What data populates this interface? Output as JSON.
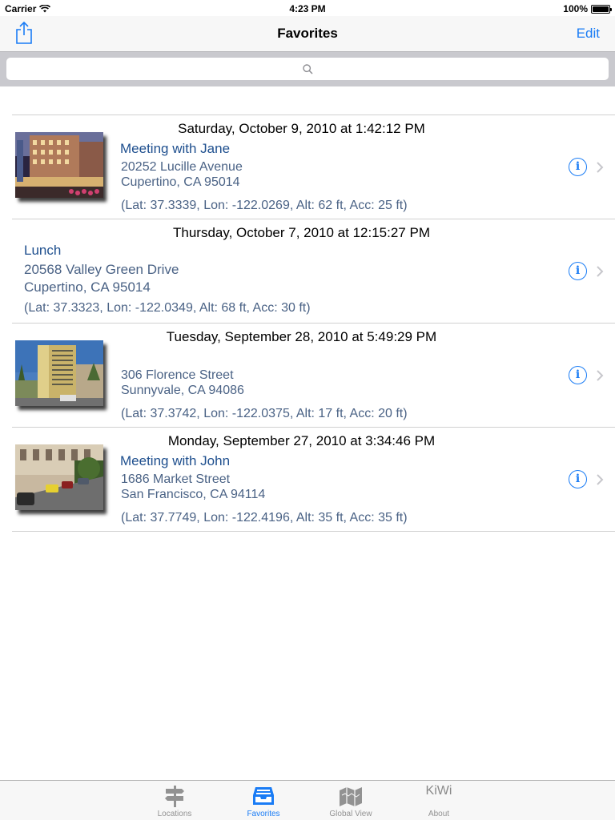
{
  "status": {
    "carrier": "Carrier",
    "time": "4:23 PM",
    "battery": "100%"
  },
  "nav": {
    "title": "Favorites",
    "edit_label": "Edit"
  },
  "search": {
    "placeholder": ""
  },
  "favorites": [
    {
      "date": "Saturday, October 9, 2010 at 1:42:12 PM",
      "title": "Meeting with Jane",
      "address1": "20252 Lucille Avenue",
      "address2": "Cupertino, CA 95014",
      "coords": "(Lat: 37.3339, Lon: -122.0269, Alt: 62 ft, Acc: 25 ft)",
      "has_photo": true
    },
    {
      "date": "Thursday, October 7, 2010 at 12:15:27 PM",
      "title": "Lunch",
      "address1": "20568 Valley Green Drive",
      "address2": "Cupertino, CA 95014",
      "coords": "(Lat: 37.3323, Lon: -122.0349, Alt: 68 ft, Acc: 30 ft)",
      "has_photo": false
    },
    {
      "date": "Tuesday, September 28, 2010 at 5:49:29 PM",
      "title": "",
      "address1": "306 Florence Street",
      "address2": "Sunnyvale, CA 94086",
      "coords": "(Lat: 37.3742, Lon: -122.0375, Alt: 17 ft, Acc: 20 ft)",
      "has_photo": true
    },
    {
      "date": "Monday, September 27, 2010 at 3:34:46 PM",
      "title": "Meeting with John",
      "address1": "1686 Market Street",
      "address2": "San Francisco, CA 94114",
      "coords": "(Lat: 37.7749, Lon: -122.4196, Alt: 35 ft, Acc: 35 ft)",
      "has_photo": true
    }
  ],
  "tabs": [
    {
      "label": "Locations",
      "icon": "signpost-icon",
      "active": false
    },
    {
      "label": "Favorites",
      "icon": "inbox-tray-icon",
      "active": true
    },
    {
      "label": "Global View",
      "icon": "folded-map-icon",
      "active": false
    },
    {
      "label": "About",
      "icon": "kiwi-logo",
      "logo_text": "KiWi",
      "active": false
    }
  ],
  "colors": {
    "accent": "#1a7cf5",
    "title_text": "#1e4f8e",
    "detail_text": "#4a6285"
  }
}
